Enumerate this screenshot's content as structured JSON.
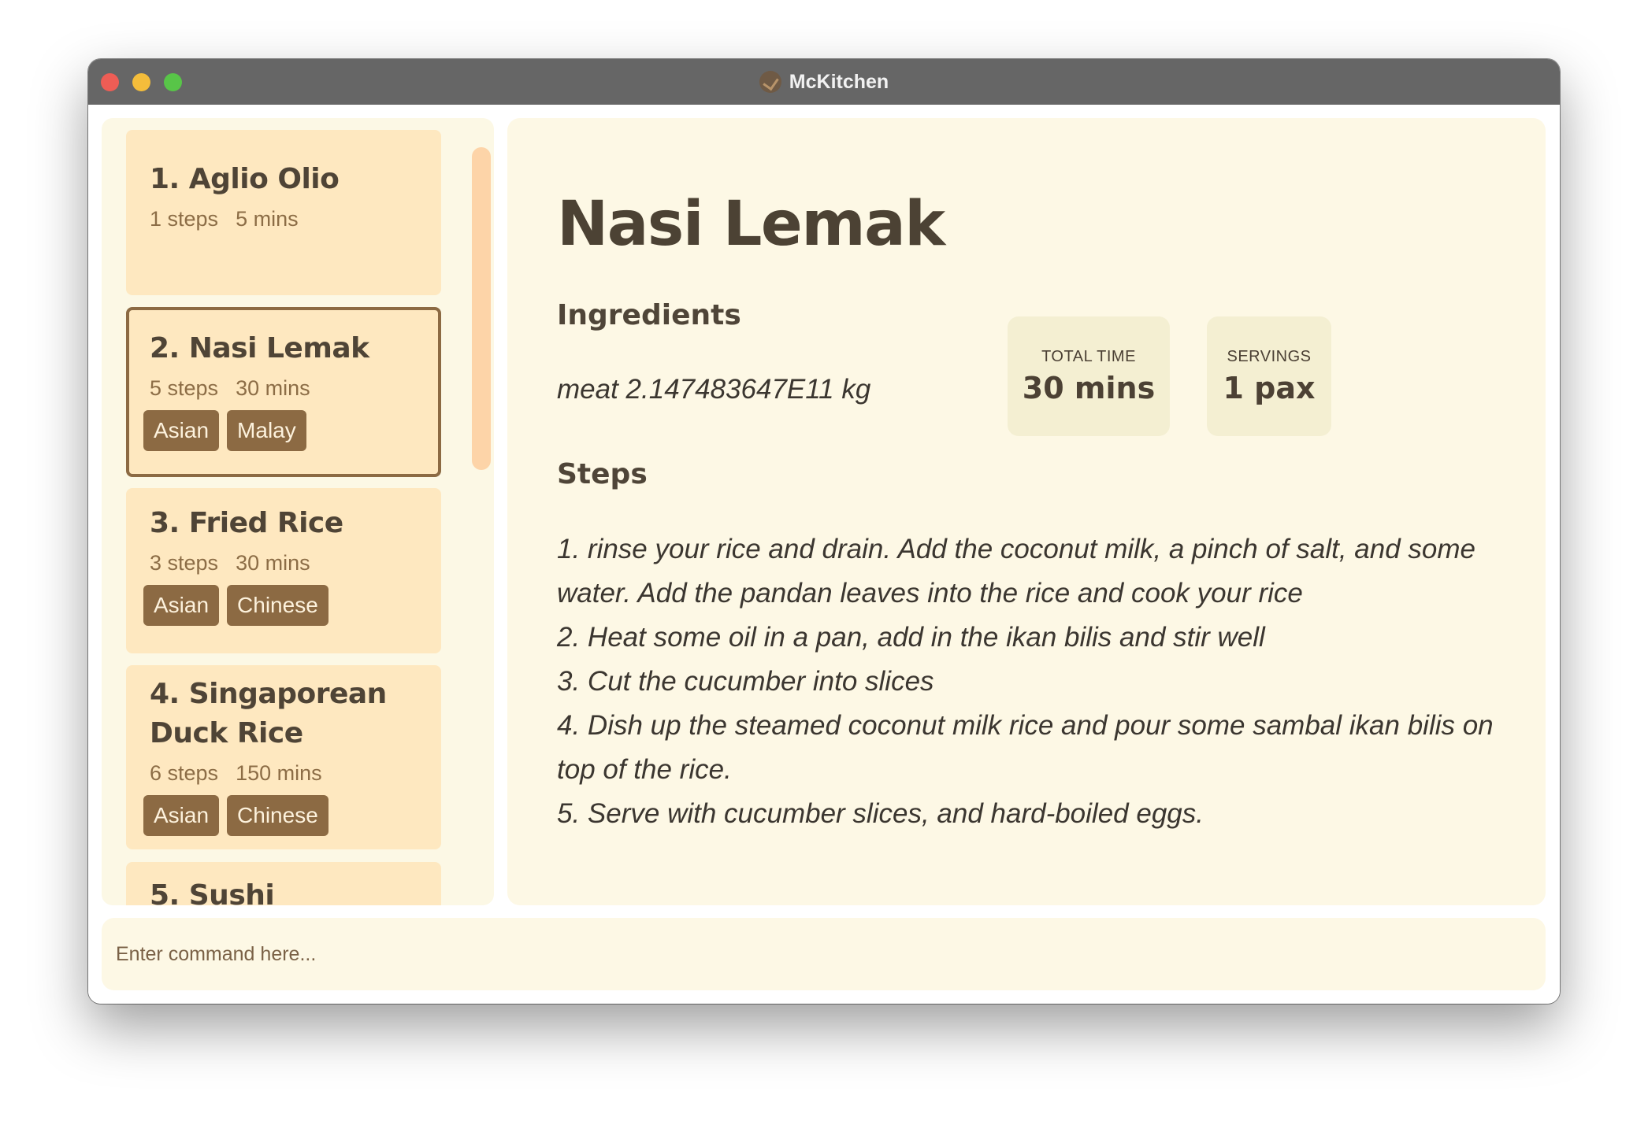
{
  "window": {
    "title": "McKitchen"
  },
  "recipes": [
    {
      "name": "1. Aglio Olio",
      "steps": "1 steps",
      "time": "5 mins",
      "tags": []
    },
    {
      "name": "2. Nasi Lemak",
      "steps": "5 steps",
      "time": "30 mins",
      "tags": [
        "Asian",
        "Malay"
      ],
      "selected": true
    },
    {
      "name": "3. Fried Rice",
      "steps": "3 steps",
      "time": "30 mins",
      "tags": [
        "Asian",
        "Chinese"
      ]
    },
    {
      "name": "4. Singaporean Duck Rice",
      "steps": "6 steps",
      "time": "150 mins",
      "tags": [
        "Asian",
        "Chinese"
      ]
    },
    {
      "name": "5. Sushi"
    }
  ],
  "detail": {
    "title": "Nasi Lemak",
    "ingredients_heading": "Ingredients",
    "ingredients": [
      "meat 2.147483647E11 kg"
    ],
    "total_time_label": "TOTAL TIME",
    "total_time_value": "30 mins",
    "servings_label": "SERVINGS",
    "servings_value": "1 pax",
    "steps_heading": "Steps",
    "steps": [
      "1. rinse your rice and drain. Add the coconut milk, a pinch of salt, and some water. Add the pandan leaves into the rice and cook your rice",
      "2. Heat some oil in a pan, add in the ikan bilis and stir well",
      "3. Cut the cucumber into slices",
      "4. Dish up the steamed coconut milk rice and pour some sambal ikan bilis on top of the rice.",
      "5. Serve with cucumber slices, and hard-boiled eggs."
    ]
  },
  "command": {
    "placeholder": "Enter command here..."
  }
}
